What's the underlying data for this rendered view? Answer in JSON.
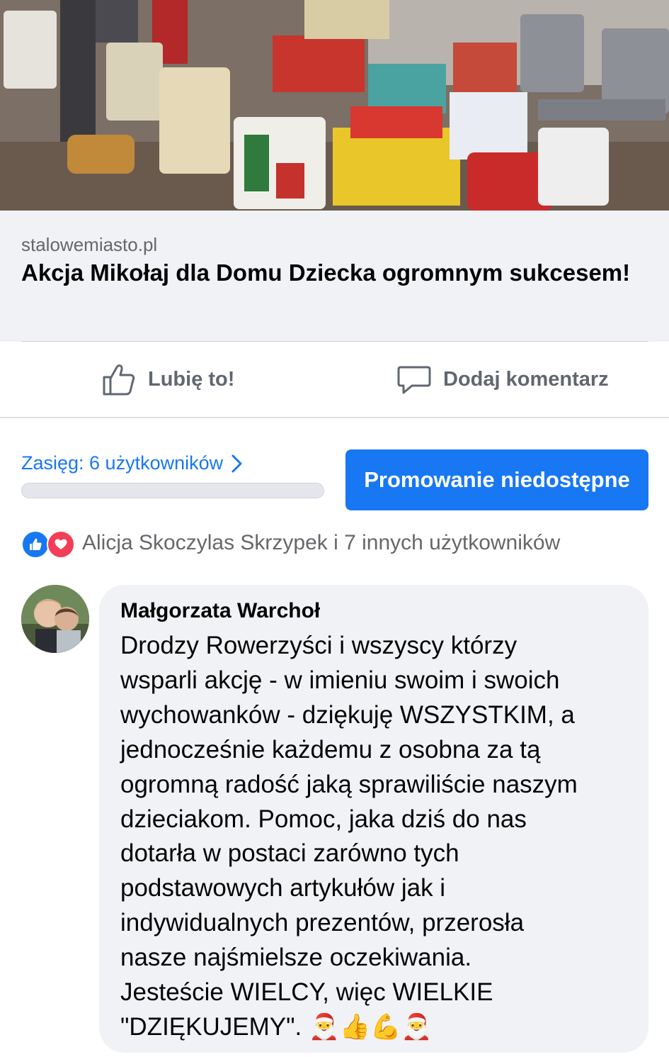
{
  "link_preview": {
    "domain": "stalowemiasto.pl",
    "title": "Akcja Mikołaj dla Domu Dziecka ogromnym sukcesem!"
  },
  "actions": {
    "like_label": "Lubię to!",
    "comment_label": "Dodaj komentarz"
  },
  "reach": {
    "label": "Zasięg: 6 użytkowników",
    "chevron": "›",
    "promote_label": "Promowanie niedostępne"
  },
  "reactions": {
    "icons": [
      "like-icon",
      "love-icon"
    ],
    "summary": "Alicja Skoczylas Skrzypek i 7 innych użytkowników"
  },
  "comment": {
    "author": "Małgorzata Warchoł",
    "text": "Drodzy Rowerzyści i wszyscy którzy\nwsparli akcję - w imieniu swoim i swoich\nwychowanków - dziękuję WSZYSTKIM, a\njednocześnie każdemu z osobna za tą\nogromną radość jaką sprawiliście naszym\ndzieciakom. Pomoc, jaka dziś do nas\ndotarła w postaci zarówno tych\npodstawowych artykułów jak i\nindywidualnych prezentów, przerosła\nnasze najśmielsze oczekiwania.\nJesteście WIELCY,  więc WIELKIE\n\"DZIĘKUJEMY\". 🎅👍💪🎅"
  },
  "colors": {
    "accent": "#1877f2",
    "love": "#f33e58",
    "bubble": "#f0f2f5"
  }
}
